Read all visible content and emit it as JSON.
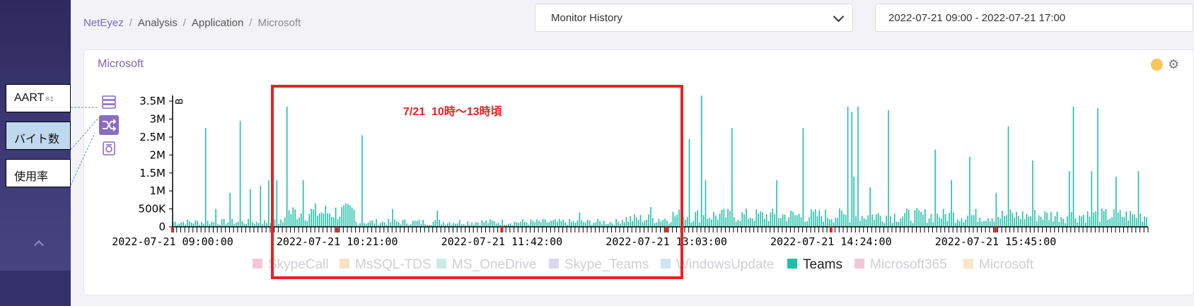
{
  "breadcrumb": [
    "NetEyez",
    "Analysis",
    "Application",
    "Microsoft"
  ],
  "mode_select": {
    "value": "Monitor History"
  },
  "date_range": {
    "value": "2022-07-21 09:00 - 2022-07-21 17:00"
  },
  "card": {
    "title": "Microsoft"
  },
  "metric_labels": {
    "aart": "AART",
    "aart_note": "※1",
    "bytes": "バイト数",
    "usage": "使用率"
  },
  "annotation": {
    "text": "7/21  10時～13時頃"
  },
  "colors": {
    "accent": "#7a67b6",
    "series": "#1ec0a8",
    "status": "#f8c65a",
    "annotation": "#e32424"
  },
  "chart_data": {
    "type": "bar",
    "ylabel": "B",
    "y_ticks": [
      "3.5M",
      "3M",
      "2.5M",
      "2M",
      "1.5M",
      "1M",
      "500K",
      "0"
    ],
    "ylim": [
      0,
      3600000
    ],
    "x_tick_labels": [
      "2022-07-21 09:00:00",
      "2022-07-21 10:21:00",
      "2022-07-21 11:42:00",
      "2022-07-21 13:03:00",
      "2022-07-21 14:24:00",
      "2022-07-21 15:45:00"
    ],
    "xlim": [
      "2022-07-21 09:00:00",
      "2022-07-21 17:00:00"
    ],
    "legend": [
      {
        "name": "SkypeCall",
        "color": "#f5c6d8",
        "active": false
      },
      {
        "name": "MsSQL-TDS",
        "color": "#f8e1c4",
        "active": false
      },
      {
        "name": "MS_OneDrive",
        "color": "#c9ece6",
        "active": false
      },
      {
        "name": "Skype_Teams",
        "color": "#dcd6ee",
        "active": false
      },
      {
        "name": "WindowsUpdate",
        "color": "#cfe4f4",
        "active": false
      },
      {
        "name": "Teams",
        "color": "#1ec0a8",
        "active": true
      },
      {
        "name": "Microsoft365",
        "color": "#f5c6d8",
        "active": false
      },
      {
        "name": "Microsoft",
        "color": "#f8e7c8",
        "active": false
      }
    ],
    "legend_position": "bottom",
    "series": [
      {
        "name": "Teams",
        "peaks": [
          {
            "time": "09:16",
            "value": 2750000
          },
          {
            "time": "09:21",
            "value": 500000
          },
          {
            "time": "09:28",
            "value": 950000
          },
          {
            "time": "09:33",
            "value": 2950000
          },
          {
            "time": "09:38",
            "value": 1050000
          },
          {
            "time": "09:43",
            "value": 1150000
          },
          {
            "time": "09:47",
            "value": 1300000
          },
          {
            "time": "09:51",
            "value": 1300000
          },
          {
            "time": "09:56",
            "value": 3350000
          },
          {
            "time": "10:04",
            "value": 1300000
          },
          {
            "time": "10:33",
            "value": 2550000
          },
          {
            "time": "10:48",
            "value": 500000
          },
          {
            "time": "11:10",
            "value": 450000
          },
          {
            "time": "12:20",
            "value": 400000
          },
          {
            "time": "12:55",
            "value": 550000
          },
          {
            "time": "13:14",
            "value": 2450000
          },
          {
            "time": "13:20",
            "value": 3650000
          },
          {
            "time": "13:22",
            "value": 1300000
          },
          {
            "time": "13:35",
            "value": 2750000
          },
          {
            "time": "13:57",
            "value": 1300000
          },
          {
            "time": "14:10",
            "value": 2750000
          },
          {
            "time": "14:32",
            "value": 3350000
          },
          {
            "time": "14:34",
            "value": 3200000
          },
          {
            "time": "14:35",
            "value": 1400000
          },
          {
            "time": "14:37",
            "value": 3350000
          },
          {
            "time": "14:43",
            "value": 1100000
          },
          {
            "time": "14:52",
            "value": 3250000
          },
          {
            "time": "15:15",
            "value": 2150000
          },
          {
            "time": "15:23",
            "value": 1300000
          },
          {
            "time": "15:32",
            "value": 1950000
          },
          {
            "time": "15:45",
            "value": 950000
          },
          {
            "time": "15:51",
            "value": 2800000
          },
          {
            "time": "16:03",
            "value": 1850000
          },
          {
            "time": "16:21",
            "value": 1550000
          },
          {
            "time": "16:23",
            "value": 3350000
          },
          {
            "time": "16:32",
            "value": 1550000
          },
          {
            "time": "16:35",
            "value": 3300000
          },
          {
            "time": "16:44",
            "value": 1400000
          },
          {
            "time": "16:55",
            "value": 1550000
          }
        ],
        "baseline": [
          {
            "from": "09:00",
            "to": "09:55",
            "value": 150000
          },
          {
            "from": "09:55",
            "to": "10:30",
            "value": 450000
          },
          {
            "from": "10:30",
            "to": "12:40",
            "value": 150000
          },
          {
            "from": "12:40",
            "to": "13:05",
            "value": 250000
          },
          {
            "from": "13:05",
            "to": "17:00",
            "value": 350000
          }
        ]
      }
    ],
    "grid": false
  }
}
